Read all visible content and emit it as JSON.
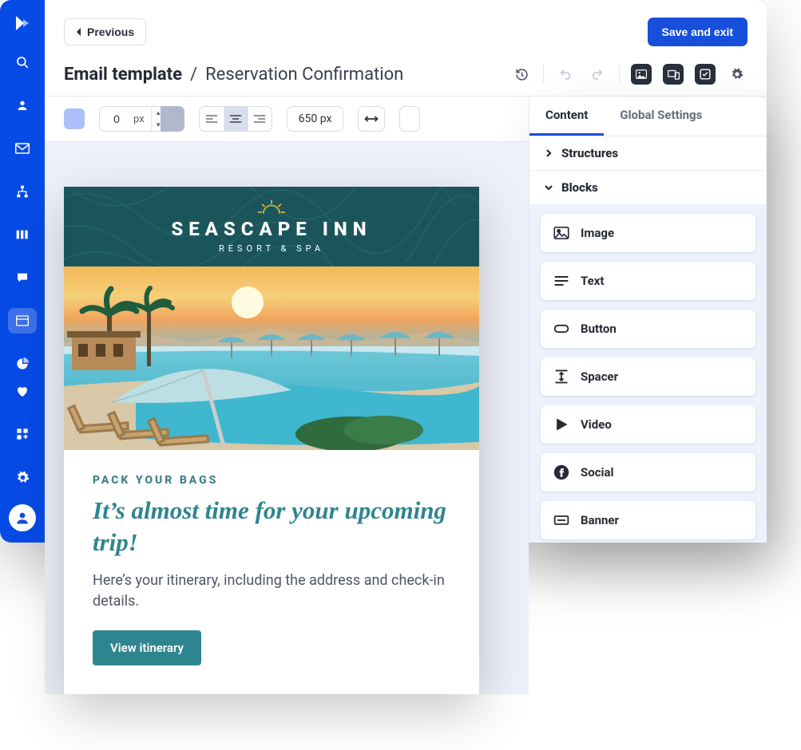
{
  "rail": {
    "logo_name": "brand-logo"
  },
  "topbar": {
    "previous_label": "Previous",
    "save_label": "Save and exit"
  },
  "title": {
    "strong": "Email template",
    "separator": "/",
    "name": "Reservation Confirmation"
  },
  "tools": {
    "bg_color": "#aebef9",
    "padding_value": "0",
    "padding_unit": "px",
    "width_label": "650 px"
  },
  "email": {
    "brand_name": "SEASCAPE INN",
    "brand_sub": "RESORT & SPA",
    "eyebrow": "PACK YOUR BAGS",
    "headline": "It’s almost time for your upcoming trip!",
    "body_text": "Here’s your itinerary, including the address and check-in details.",
    "cta_label": "View itinerary"
  },
  "panel": {
    "tabs": {
      "content": "Content",
      "global": "Global Settings"
    },
    "sections": {
      "structures": "Structures",
      "blocks": "Blocks"
    },
    "blocks": [
      {
        "key": "image",
        "label": "Image"
      },
      {
        "key": "text",
        "label": "Text"
      },
      {
        "key": "button",
        "label": "Button"
      },
      {
        "key": "spacer",
        "label": "Spacer"
      },
      {
        "key": "video",
        "label": "Video"
      },
      {
        "key": "social",
        "label": "Social"
      },
      {
        "key": "banner",
        "label": "Banner"
      }
    ]
  }
}
